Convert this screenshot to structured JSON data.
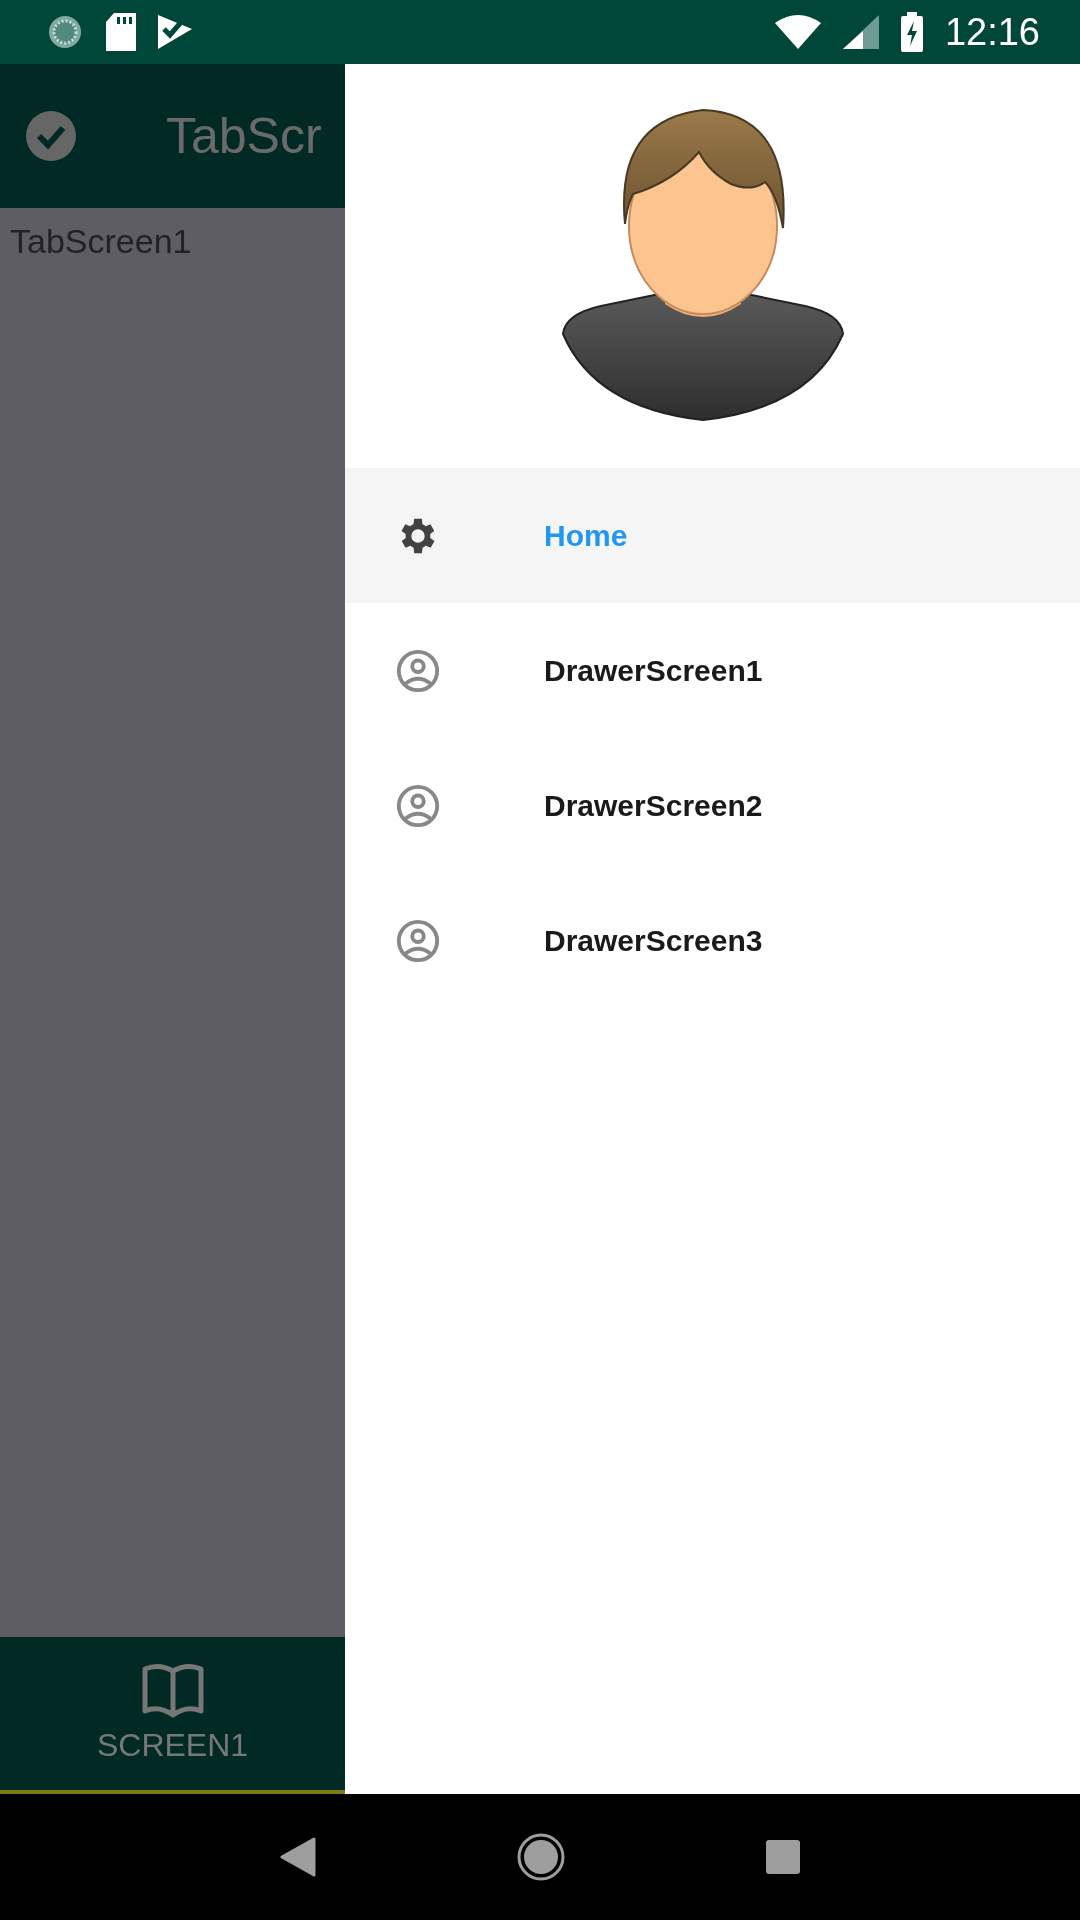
{
  "status_bar": {
    "time": "12:16"
  },
  "app_bar": {
    "title": "TabScr"
  },
  "content": {
    "text": "TabScreen1"
  },
  "bottom_tabs": [
    {
      "label": "SCREEN1",
      "selected": true
    }
  ],
  "drawer": {
    "items": [
      {
        "label": "Home",
        "kind": "settings",
        "selected": true
      },
      {
        "label": "DrawerScreen1",
        "kind": "account",
        "selected": false
      },
      {
        "label": "DrawerScreen2",
        "kind": "account",
        "selected": false
      },
      {
        "label": "DrawerScreen3",
        "kind": "account",
        "selected": false
      }
    ]
  }
}
